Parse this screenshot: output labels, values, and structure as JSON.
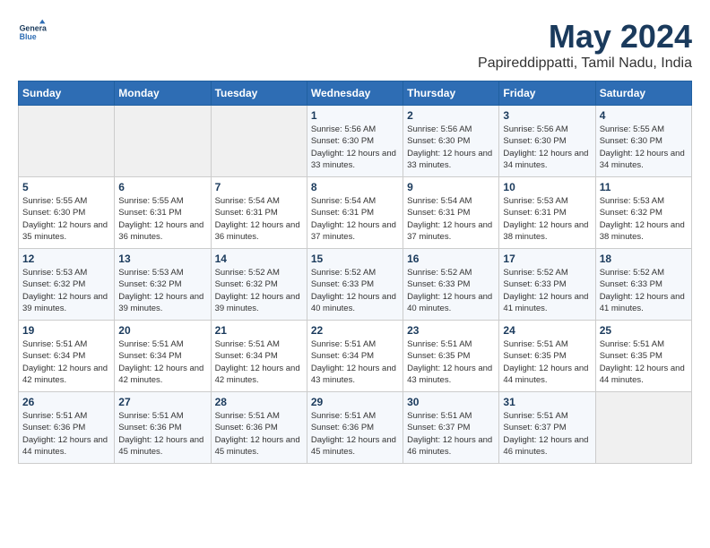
{
  "logo": {
    "line1": "General",
    "line2": "Blue"
  },
  "title": "May 2024",
  "subtitle": "Papireddippatti, Tamil Nadu, India",
  "days_of_week": [
    "Sunday",
    "Monday",
    "Tuesday",
    "Wednesday",
    "Thursday",
    "Friday",
    "Saturday"
  ],
  "weeks": [
    [
      {
        "day": "",
        "info": ""
      },
      {
        "day": "",
        "info": ""
      },
      {
        "day": "",
        "info": ""
      },
      {
        "day": "1",
        "info": "Sunrise: 5:56 AM\nSunset: 6:30 PM\nDaylight: 12 hours\nand 33 minutes."
      },
      {
        "day": "2",
        "info": "Sunrise: 5:56 AM\nSunset: 6:30 PM\nDaylight: 12 hours\nand 33 minutes."
      },
      {
        "day": "3",
        "info": "Sunrise: 5:56 AM\nSunset: 6:30 PM\nDaylight: 12 hours\nand 34 minutes."
      },
      {
        "day": "4",
        "info": "Sunrise: 5:55 AM\nSunset: 6:30 PM\nDaylight: 12 hours\nand 34 minutes."
      }
    ],
    [
      {
        "day": "5",
        "info": "Sunrise: 5:55 AM\nSunset: 6:30 PM\nDaylight: 12 hours\nand 35 minutes."
      },
      {
        "day": "6",
        "info": "Sunrise: 5:55 AM\nSunset: 6:31 PM\nDaylight: 12 hours\nand 36 minutes."
      },
      {
        "day": "7",
        "info": "Sunrise: 5:54 AM\nSunset: 6:31 PM\nDaylight: 12 hours\nand 36 minutes."
      },
      {
        "day": "8",
        "info": "Sunrise: 5:54 AM\nSunset: 6:31 PM\nDaylight: 12 hours\nand 37 minutes."
      },
      {
        "day": "9",
        "info": "Sunrise: 5:54 AM\nSunset: 6:31 PM\nDaylight: 12 hours\nand 37 minutes."
      },
      {
        "day": "10",
        "info": "Sunrise: 5:53 AM\nSunset: 6:31 PM\nDaylight: 12 hours\nand 38 minutes."
      },
      {
        "day": "11",
        "info": "Sunrise: 5:53 AM\nSunset: 6:32 PM\nDaylight: 12 hours\nand 38 minutes."
      }
    ],
    [
      {
        "day": "12",
        "info": "Sunrise: 5:53 AM\nSunset: 6:32 PM\nDaylight: 12 hours\nand 39 minutes."
      },
      {
        "day": "13",
        "info": "Sunrise: 5:53 AM\nSunset: 6:32 PM\nDaylight: 12 hours\nand 39 minutes."
      },
      {
        "day": "14",
        "info": "Sunrise: 5:52 AM\nSunset: 6:32 PM\nDaylight: 12 hours\nand 39 minutes."
      },
      {
        "day": "15",
        "info": "Sunrise: 5:52 AM\nSunset: 6:33 PM\nDaylight: 12 hours\nand 40 minutes."
      },
      {
        "day": "16",
        "info": "Sunrise: 5:52 AM\nSunset: 6:33 PM\nDaylight: 12 hours\nand 40 minutes."
      },
      {
        "day": "17",
        "info": "Sunrise: 5:52 AM\nSunset: 6:33 PM\nDaylight: 12 hours\nand 41 minutes."
      },
      {
        "day": "18",
        "info": "Sunrise: 5:52 AM\nSunset: 6:33 PM\nDaylight: 12 hours\nand 41 minutes."
      }
    ],
    [
      {
        "day": "19",
        "info": "Sunrise: 5:51 AM\nSunset: 6:34 PM\nDaylight: 12 hours\nand 42 minutes."
      },
      {
        "day": "20",
        "info": "Sunrise: 5:51 AM\nSunset: 6:34 PM\nDaylight: 12 hours\nand 42 minutes."
      },
      {
        "day": "21",
        "info": "Sunrise: 5:51 AM\nSunset: 6:34 PM\nDaylight: 12 hours\nand 42 minutes."
      },
      {
        "day": "22",
        "info": "Sunrise: 5:51 AM\nSunset: 6:34 PM\nDaylight: 12 hours\nand 43 minutes."
      },
      {
        "day": "23",
        "info": "Sunrise: 5:51 AM\nSunset: 6:35 PM\nDaylight: 12 hours\nand 43 minutes."
      },
      {
        "day": "24",
        "info": "Sunrise: 5:51 AM\nSunset: 6:35 PM\nDaylight: 12 hours\nand 44 minutes."
      },
      {
        "day": "25",
        "info": "Sunrise: 5:51 AM\nSunset: 6:35 PM\nDaylight: 12 hours\nand 44 minutes."
      }
    ],
    [
      {
        "day": "26",
        "info": "Sunrise: 5:51 AM\nSunset: 6:36 PM\nDaylight: 12 hours\nand 44 minutes."
      },
      {
        "day": "27",
        "info": "Sunrise: 5:51 AM\nSunset: 6:36 PM\nDaylight: 12 hours\nand 45 minutes."
      },
      {
        "day": "28",
        "info": "Sunrise: 5:51 AM\nSunset: 6:36 PM\nDaylight: 12 hours\nand 45 minutes."
      },
      {
        "day": "29",
        "info": "Sunrise: 5:51 AM\nSunset: 6:36 PM\nDaylight: 12 hours\nand 45 minutes."
      },
      {
        "day": "30",
        "info": "Sunrise: 5:51 AM\nSunset: 6:37 PM\nDaylight: 12 hours\nand 46 minutes."
      },
      {
        "day": "31",
        "info": "Sunrise: 5:51 AM\nSunset: 6:37 PM\nDaylight: 12 hours\nand 46 minutes."
      },
      {
        "day": "",
        "info": ""
      }
    ]
  ]
}
